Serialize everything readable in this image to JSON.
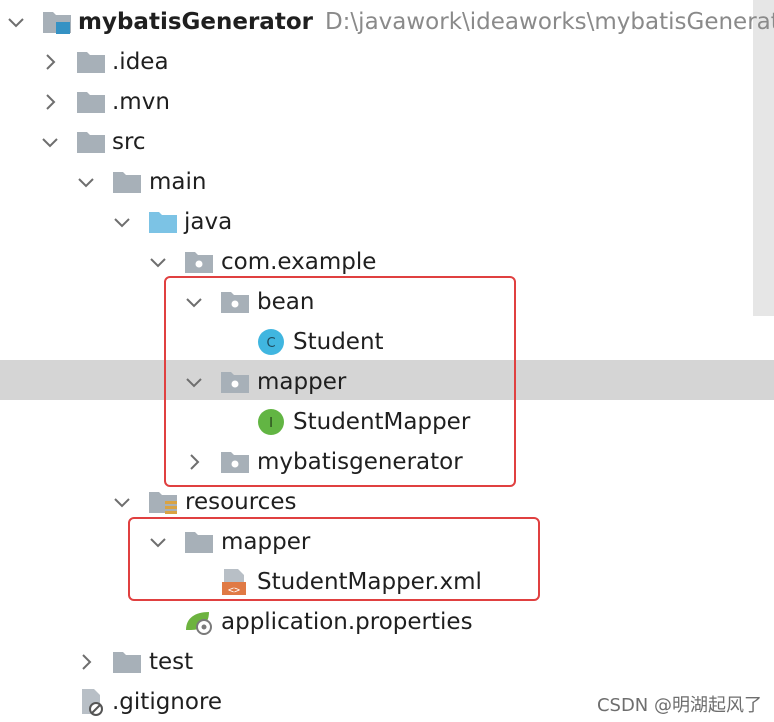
{
  "tree": {
    "root": {
      "name": "mybatisGenerator",
      "path": "D:\\javawork\\ideaworks\\mybatisGenerato"
    },
    "items": [
      {
        "label": ".idea"
      },
      {
        "label": ".mvn"
      },
      {
        "label": "src"
      },
      {
        "label": "main"
      },
      {
        "label": "java"
      },
      {
        "label": "com.example"
      },
      {
        "label": "bean"
      },
      {
        "label": "Student",
        "badge": "C"
      },
      {
        "label": "mapper"
      },
      {
        "label": "StudentMapper",
        "badge": "I"
      },
      {
        "label": "mybatisgenerator"
      },
      {
        "label": "resources"
      },
      {
        "label": "mapper"
      },
      {
        "label": "StudentMapper.xml",
        "badge": "<>"
      },
      {
        "label": "application.properties"
      },
      {
        "label": "test"
      },
      {
        "label": ".gitignore"
      }
    ]
  },
  "watermark": "CSDN @明湖起风了",
  "colors": {
    "folder": "#a7b0b8",
    "source_folder": "#7cc3e5",
    "class_icon": "#40b6e0",
    "interface_icon": "#62b543",
    "xml_icon": "#e07a45",
    "selected_row": "#d5d5d5",
    "highlight_box": "#e04040"
  }
}
